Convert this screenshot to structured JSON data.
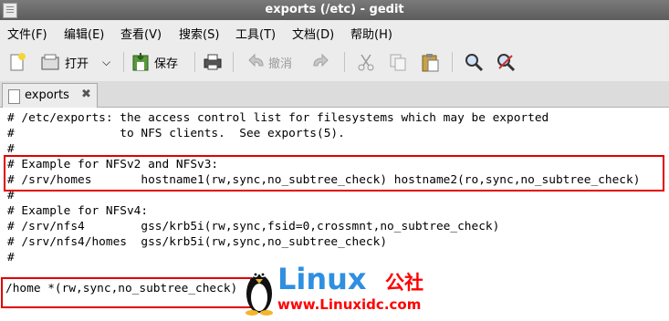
{
  "window": {
    "title": "exports (/etc) - gedit"
  },
  "menu": [
    "文件(F)",
    "编辑(E)",
    "查看(V)",
    "搜索(S)",
    "工具(T)",
    "文档(D)",
    "帮助(H)"
  ],
  "toolbar": {
    "new_icon": "new-document-icon",
    "open_label": "打开",
    "save_label": "保存",
    "undo_label": "撤消"
  },
  "tab": {
    "label": "exports",
    "close": "✖"
  },
  "editor": {
    "lines": [
      "# /etc/exports: the access control list for filesystems which may be exported",
      "#               to NFS clients.  See exports(5).",
      "#",
      "# Example for NFSv2 and NFSv3:",
      "# /srv/homes       hostname1(rw,sync,no_subtree_check) hostname2(ro,sync,no_subtree_check)",
      "#",
      "# Example for NFSv4:",
      "# /srv/nfs4        gss/krb5i(rw,sync,fsid=0,crossmnt,no_subtree_check)",
      "# /srv/nfs4/homes  gss/krb5i(rw,sync,no_subtree_check)",
      "#",
      "",
      "/home *(rw,sync,no_subtree_check)"
    ]
  },
  "watermark": {
    "brand": "Linux",
    "cn": "公社",
    "url": "www.Linuxidc.com"
  },
  "colors": {
    "highlight": "#e00000",
    "brand_blue": "#2f8fe0",
    "brand_red": "#ff0000"
  }
}
